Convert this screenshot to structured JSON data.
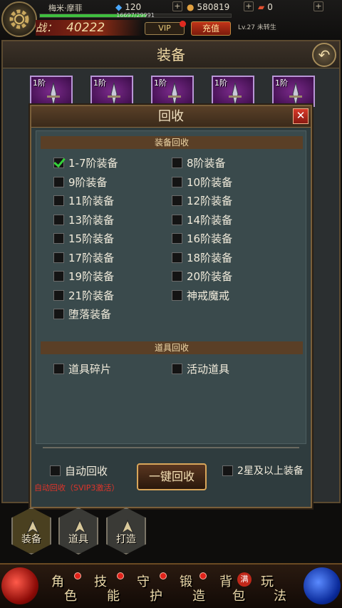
{
  "player": {
    "name": "梅米·摩菲",
    "diamonds": "120",
    "gold": "580819",
    "vouchers": "0",
    "exp_text": "16697/29991",
    "exp_progress": 0.557,
    "power_label": "战：",
    "power_value": "40222",
    "level_text": "Lv.27 未转生"
  },
  "buttons": {
    "vip": "VIP",
    "recharge": "充值"
  },
  "equipment_page": {
    "title": "装备",
    "slots": [
      "1阶",
      "1阶",
      "1阶",
      "1阶",
      "1阶"
    ]
  },
  "dialog": {
    "title": "回收",
    "equip_section": "装备回收",
    "equip_options": [
      {
        "label": "1-7阶装备",
        "checked": true
      },
      {
        "label": "8阶装备",
        "checked": false
      },
      {
        "label": "9阶装备",
        "checked": false
      },
      {
        "label": "10阶装备",
        "checked": false
      },
      {
        "label": "11阶装备",
        "checked": false
      },
      {
        "label": "12阶装备",
        "checked": false
      },
      {
        "label": "13阶装备",
        "checked": false
      },
      {
        "label": "14阶装备",
        "checked": false
      },
      {
        "label": "15阶装备",
        "checked": false
      },
      {
        "label": "16阶装备",
        "checked": false
      },
      {
        "label": "17阶装备",
        "checked": false
      },
      {
        "label": "18阶装备",
        "checked": false
      },
      {
        "label": "19阶装备",
        "checked": false
      },
      {
        "label": "20阶装备",
        "checked": false
      },
      {
        "label": "21阶装备",
        "checked": false
      },
      {
        "label": "神戒魔戒",
        "checked": false
      },
      {
        "label": "堕落装备",
        "checked": false
      }
    ],
    "item_section": "道具回收",
    "item_options": [
      {
        "label": "道具碎片",
        "checked": false
      },
      {
        "label": "活动道具",
        "checked": false
      }
    ],
    "auto_recycle": {
      "label": "自动回收",
      "checked": false
    },
    "auto_note": "自动回收（SVIP3激活）",
    "one_key": "一键回收",
    "two_star": {
      "label": "2星及以上装备",
      "checked": false
    }
  },
  "side_tabs": [
    "装备",
    "道具",
    "打造"
  ],
  "bottom_nav": [
    {
      "c1": "角",
      "c2": "色"
    },
    {
      "c1": "技",
      "c2": "能"
    },
    {
      "c1": "守",
      "c2": "护"
    },
    {
      "c1": "锻",
      "c2": "造"
    },
    {
      "c1": "背",
      "c2": "包"
    },
    {
      "c1": "玩",
      "c2": "法"
    }
  ],
  "bag_badge": "满"
}
